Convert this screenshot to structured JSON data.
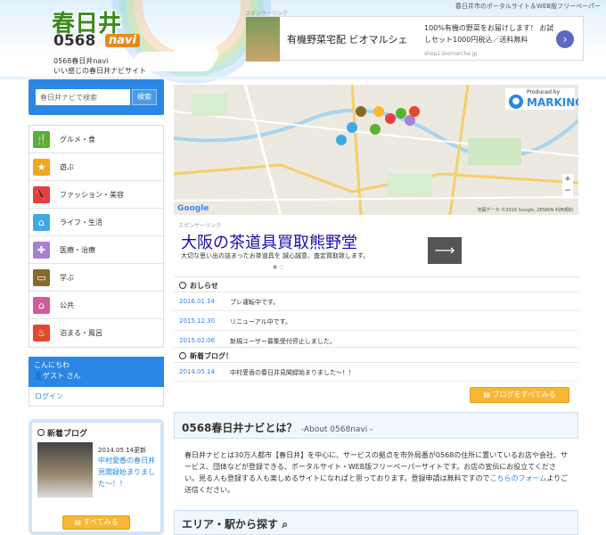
{
  "header": {
    "logo_main": "春日井",
    "logo_num": "0568",
    "logo_navi": "navi",
    "tagline_1": "0568春日井navi",
    "tagline_2": "いい感じの春日井ナビサイト",
    "top_right": "春日井市のポータルサイト＆WEB版フリーペーパー",
    "ad_label": "スポンサーリンク",
    "ad_title": "有機野菜宅配 ビオマルシェ",
    "ad_desc": "100%有機の野菜をお届けします！ お試しセット1000円税込／送料無料",
    "ad_url": "shop2.biomarche.jp",
    "ad_arrow": "›"
  },
  "search": {
    "placeholder": "春日井ナビで検索",
    "button": "検索"
  },
  "categories": [
    {
      "label": "グルメ・食",
      "icon": "food-icon",
      "color": "#5ab034",
      "glyph": "🍴"
    },
    {
      "label": "遊ぶ",
      "icon": "play-icon",
      "color": "#f0a81e",
      "glyph": "★"
    },
    {
      "label": "ファッション・美容",
      "icon": "fashion-icon",
      "color": "#e64040",
      "glyph": "👠"
    },
    {
      "label": "ライフ・生活",
      "icon": "life-icon",
      "color": "#3fa9e8",
      "glyph": "⌂"
    },
    {
      "label": "医療・治療",
      "icon": "medical-icon",
      "color": "#a77fd6",
      "glyph": "✚"
    },
    {
      "label": "学ぶ",
      "icon": "study-icon",
      "color": "#8a6a2a",
      "glyph": "▭"
    },
    {
      "label": "公共",
      "icon": "public-icon",
      "color": "#d25aa0",
      "glyph": "⌂"
    },
    {
      "label": "泊まる・風呂",
      "icon": "hotspring-icon",
      "color": "#e04a2a",
      "glyph": "♨"
    }
  ],
  "user": {
    "greeting": "こんにちわ",
    "name": "ゲスト さん",
    "login": "ログイン"
  },
  "newblog": {
    "heading": "新着ブログ",
    "date": "2014.05.14更新",
    "title": "中村愛香の春日井見聞録始まりました～！！",
    "see_all": "すべてみる"
  },
  "map": {
    "brand": "MARKING",
    "produced": "Produced by",
    "google": "Google",
    "copyright": "地図データ ©2016 Google, ZENRIN 利用規約"
  },
  "ad2": {
    "label": "スポンサーリンク",
    "headline": "大阪の茶道具買取熊野堂",
    "sub": "大切な思い出の詰まったお茶道具を 誠心誠意、査定買取致します。",
    "arrow": "⟶"
  },
  "news": {
    "heading": "おしらせ",
    "items": [
      {
        "date": "2016.01.14",
        "text": "プレ運転中です。"
      },
      {
        "date": "2015.12.30",
        "text": "リニューアル中です。"
      },
      {
        "date": "2015.02.06",
        "text": "新規ユーザー募集受付停止しました。"
      }
    ]
  },
  "blog": {
    "heading": "新着ブログ！",
    "items": [
      {
        "date": "2014.05.14",
        "text": "中村愛香の春日井見聞録始まりました～！！"
      }
    ],
    "see_all": "ブログをすべてみる"
  },
  "about": {
    "title": "0568春日井ナビとは？",
    "subtitle": "-About 0568navi -",
    "body": "春日井ナビとは30万人都市【春日井】を中心に、サービスの拠点を市外局番が0568の住所に置いているお店や会社、サービス、団体などが登録できる、ポータルサイト・WEB版フリーペーパーサイトです。お店の宣伝にお役立てください。見る人も登録する人も楽しめるサイトになればと思っております。登録申請は無料ですので",
    "link": "こちらのフォーム",
    "body_end": "よりご送信ください。"
  },
  "area": {
    "title": "エリア・駅から探す"
  }
}
